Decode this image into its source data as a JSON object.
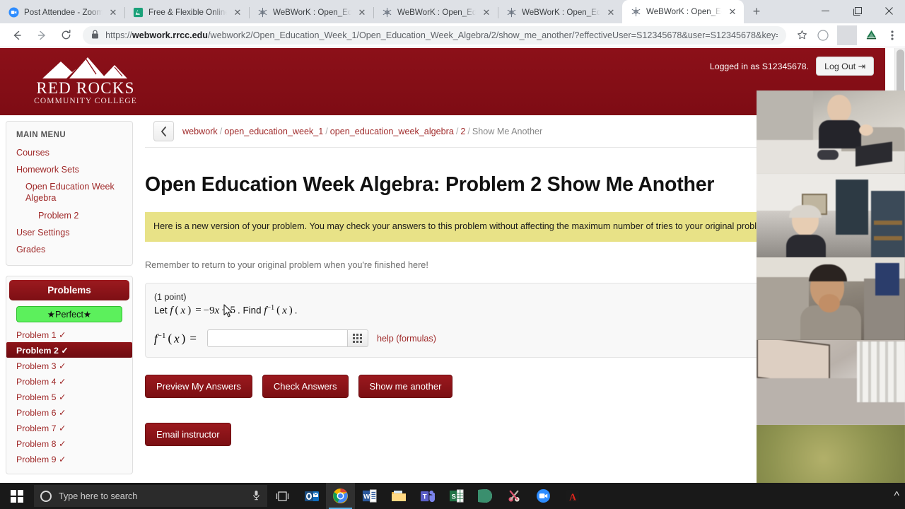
{
  "browser": {
    "tabs": [
      {
        "title": "Post Attendee - Zoom",
        "favicon": "zoom-icon",
        "active": false
      },
      {
        "title": "Free & Flexible Online h",
        "favicon": "green-doc-icon",
        "active": false
      },
      {
        "title": "WeBWorK : Open_Educ",
        "favicon": "webwork-icon",
        "active": false
      },
      {
        "title": "WeBWorK : Open_Educ",
        "favicon": "webwork-icon",
        "active": false
      },
      {
        "title": "WeBWorK : Open_Educ",
        "favicon": "webwork-icon",
        "active": false
      },
      {
        "title": "WeBWorK : Open_Educ",
        "favicon": "webwork-icon",
        "active": true
      }
    ],
    "new_tab_label": "+",
    "window_controls": {
      "minimize": "–",
      "maximize": "❐",
      "close": "✕"
    },
    "back_label": "←",
    "forward_label": "→",
    "reload_label": "⟳",
    "url_scheme": "https://",
    "url_host": "webwork.rrcc.edu",
    "url_path": "/webwork2/Open_Education_Week_1/Open_Education_Week_Algebra/2/show_me_another/?effectiveUser=S12345678&user=S12345678&key=yf…",
    "bookmark_label": "☆",
    "profile_label": "○",
    "menu_label": "⋮"
  },
  "site": {
    "logo_name": "RED ROCKS",
    "logo_sub": "COMMUNITY COLLEGE",
    "logged_in_as": "Logged in as S12345678.",
    "logout_label": "Log Out",
    "logout_icon": "sign-out-icon",
    "brand_color": "#8a1318"
  },
  "sidebar": {
    "main_menu_title": "MAIN MENU",
    "items": [
      {
        "label": "Courses",
        "indent": 0
      },
      {
        "label": "Homework Sets",
        "indent": 0
      },
      {
        "label": "Open Education Week Algebra",
        "indent": 1
      },
      {
        "label": "Problem 2",
        "indent": 2
      },
      {
        "label": "User Settings",
        "indent": 0
      },
      {
        "label": "Grades",
        "indent": 0
      }
    ],
    "problems_title": "Problems",
    "perfect_badge": "★Perfect★",
    "problems": [
      {
        "label": "Problem 1",
        "status": "✓",
        "current": false
      },
      {
        "label": "Problem 2",
        "status": "✓",
        "current": true
      },
      {
        "label": "Problem 3",
        "status": "✓",
        "current": false
      },
      {
        "label": "Problem 4",
        "status": "✓",
        "current": false
      },
      {
        "label": "Problem 5",
        "status": "✓",
        "current": false
      },
      {
        "label": "Problem 6",
        "status": "✓",
        "current": false
      },
      {
        "label": "Problem 7",
        "status": "✓",
        "current": false
      },
      {
        "label": "Problem 8",
        "status": "✓",
        "current": false
      },
      {
        "label": "Problem 9",
        "status": "✓",
        "current": false
      }
    ]
  },
  "breadcrumb": {
    "toggle_icon": "chevron-left-icon",
    "items": [
      "webwork",
      "open_education_week_1",
      "open_education_week_algebra",
      "2",
      "Show Me Another"
    ],
    "separator": "/"
  },
  "main": {
    "page_title": "Open Education Week Algebra: Problem 2 Show Me Another",
    "alert_text": "Here is a new version of your problem. You may check your answers to this problem without affecting the maximum number of tries to your original problem.",
    "note_text": "Remember to return to your original problem when you're finished here!",
    "problem": {
      "points": "(1 point)",
      "statement_prefix": "Let",
      "function_name": "f",
      "variable": "x",
      "coefficient": "−9",
      "constant": "− 5",
      "find_word": "Find",
      "inverse_label": "f",
      "inverse_exponent": "−1",
      "statement_plain": "Let f(x) = −9x − 5. Find f⁻¹(x).",
      "answer_prompt_plain": "f⁻¹(x) =",
      "answer_value": "",
      "answer_placeholder": "",
      "keyboard_icon": "math-keypad-icon",
      "help_link": "help (formulas)"
    },
    "buttons": {
      "preview": "Preview My Answers",
      "check": "Check Answers",
      "show_another": "Show me another",
      "email": "Email instructor"
    }
  },
  "video_panel": {
    "tiles": [
      {
        "name": "participant-tile-1"
      },
      {
        "name": "participant-tile-2"
      },
      {
        "name": "participant-tile-3"
      },
      {
        "name": "participant-tile-4"
      },
      {
        "name": "participant-tile-5"
      }
    ]
  },
  "taskbar": {
    "start_icon": "windows-start-icon",
    "search_placeholder": "Type here to search",
    "cortana_icon": "cortana-circle-icon",
    "mic_icon": "microphone-icon",
    "task_view_icon": "task-view-icon",
    "apps": [
      {
        "name": "outlook-icon",
        "label": "Outlook",
        "active": false
      },
      {
        "name": "chrome-icon",
        "label": "Google Chrome",
        "active": true
      },
      {
        "name": "word-icon",
        "label": "Word",
        "active": false
      },
      {
        "name": "file-explorer-icon",
        "label": "File Explorer",
        "active": false
      },
      {
        "name": "teams-icon",
        "label": "Microsoft Teams",
        "active": false
      },
      {
        "name": "excel-icon",
        "label": "Excel",
        "active": false
      },
      {
        "name": "browser-globe-icon",
        "label": "Browser",
        "active": false
      },
      {
        "name": "snipping-tool-icon",
        "label": "Snipping Tool",
        "active": false
      },
      {
        "name": "zoom-icon",
        "label": "Zoom",
        "active": false
      },
      {
        "name": "acrobat-icon",
        "label": "Adobe Acrobat",
        "active": false
      }
    ]
  }
}
